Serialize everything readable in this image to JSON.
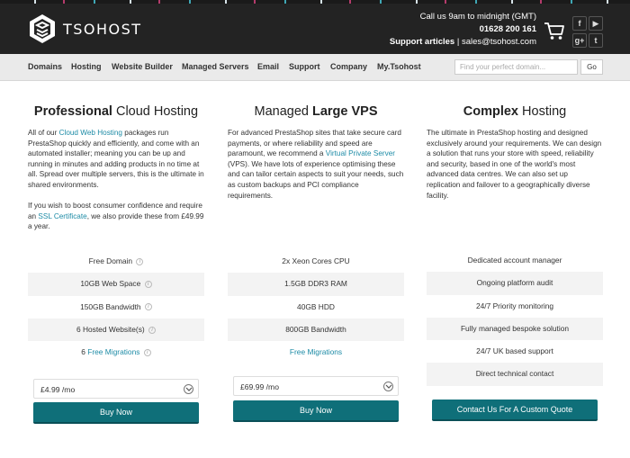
{
  "brand": {
    "name": "TSOHOST"
  },
  "header": {
    "hours": "Call us 9am to midnight (GMT)",
    "phone": "01628 200 161",
    "support_label": "Support articles",
    "support_separator": " | ",
    "email": "sales@tsohost.com"
  },
  "social": {
    "facebook": "f",
    "youtube": "▶",
    "googleplus": "g+",
    "twitter": "t"
  },
  "nav": {
    "items": [
      "Domains",
      "Hosting",
      "Website Builder",
      "Managed Servers",
      "Email",
      "Support",
      "Company",
      "My.Tsohost"
    ],
    "search_placeholder": "Find your perfect domain...",
    "go_label": "Go"
  },
  "columns": [
    {
      "title_light_before": "",
      "title_bold": "Professional",
      "title_light_after": " Cloud Hosting",
      "desc": [
        {
          "before": "All of our ",
          "link": "Cloud Web Hosting",
          "after": " packages run PrestaShop quickly and efficiently, and come with an automated installer; meaning you can be up and running in minutes and adding products in no time at all. Spread over multiple servers, this is the ultimate in shared environments."
        },
        {
          "before": "If you wish to boost consumer confidence and require an ",
          "link": "SSL Certificate",
          "after": ", we also provide these from £49.99 a year."
        }
      ],
      "features": [
        "Free Domain",
        "10GB Web Space",
        "150GB Bandwidth",
        "6 Hosted Website(s)"
      ],
      "migration_prefix": "6 ",
      "migration_link": "Free Migrations",
      "price": "£4.99 /mo",
      "button": "Buy Now"
    },
    {
      "title_light_before": "Managed ",
      "title_bold": "Large VPS",
      "title_light_after": "",
      "desc": [
        {
          "before": "For advanced PrestaShop sites that take secure card payments, or where reliability and speed are paramount, we recommend a ",
          "link": "Virtual Private Server",
          "after": " (VPS). We have lots of experience optimising these and can tailor certain aspects to suit your needs, such as custom backups and PCI compliance requirements."
        }
      ],
      "features": [
        "2x Xeon Cores CPU",
        "1.5GB DDR3 RAM",
        "40GB HDD",
        "800GB Bandwidth"
      ],
      "migration_prefix": "",
      "migration_link": "Free Migrations",
      "price": "£69.99 /mo",
      "button": "Buy Now"
    },
    {
      "title_light_before": "",
      "title_bold": "Complex",
      "title_light_after": " Hosting",
      "desc": [
        {
          "before": "The ultimate in PrestaShop hosting and designed exclusively around your requirements. We can design a solution that runs your store with speed, reliability and security, based in one of the world's most advanced data centres. We can also set up replication and failover to a geographically diverse facility.",
          "link": "",
          "after": ""
        }
      ],
      "features": [
        "Dedicated account manager",
        "Ongoing platform audit",
        "24/7 Priority monitoring",
        "Fully managed bespoke solution",
        "24/7 UK based support",
        "Direct technical contact"
      ],
      "button": "Contact Us For A Custom Quote"
    }
  ],
  "colors": {
    "header_bg": "#232323",
    "nav_bg": "#eaeaea",
    "button_teal": "#0f6f79",
    "link_blue": "#1d8ba6"
  },
  "icons": {
    "logo": "tsohost-logo-icon",
    "cart": "cart-icon",
    "info": "info-icon",
    "select_arrow": "chevron-down-icon"
  }
}
